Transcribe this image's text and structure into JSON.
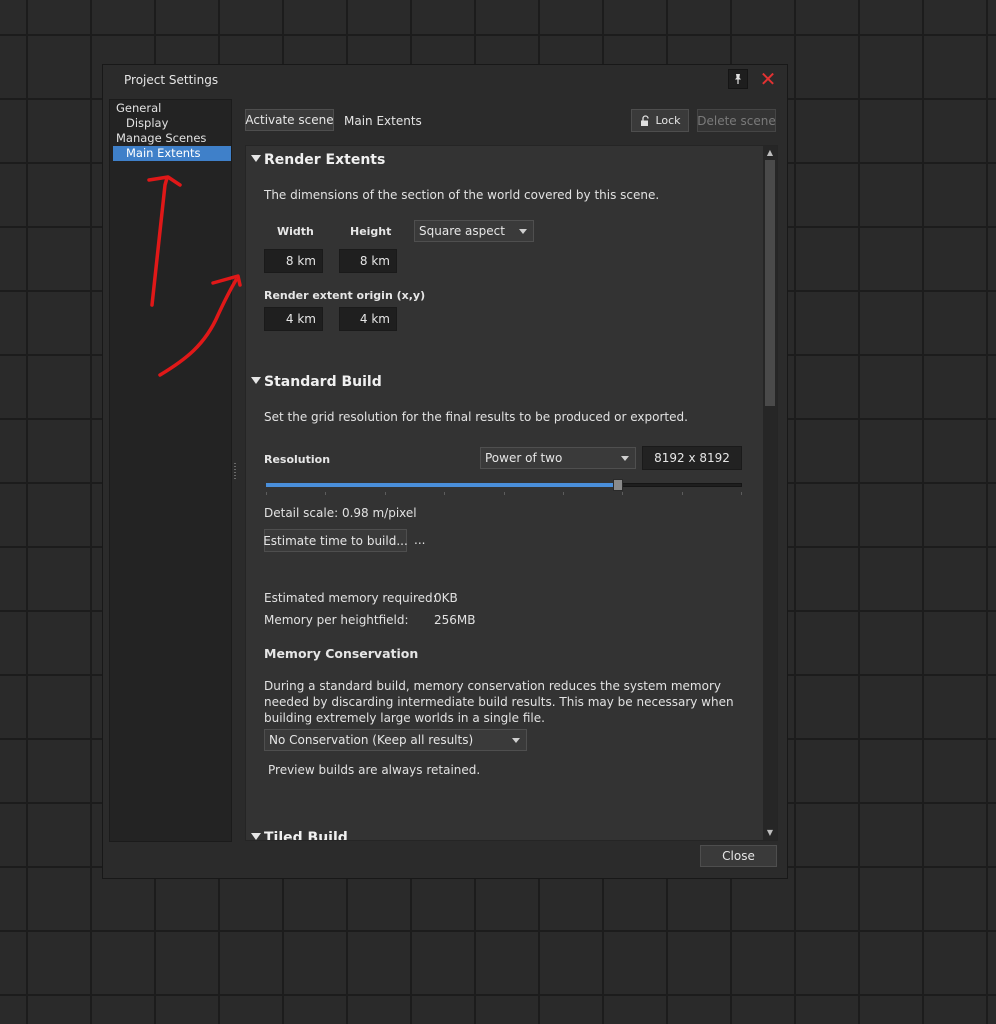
{
  "window": {
    "title": "Project Settings"
  },
  "tree": {
    "items": [
      {
        "label": "General",
        "indent": false,
        "selected": false
      },
      {
        "label": "Display",
        "indent": true,
        "selected": false
      },
      {
        "label": "Manage Scenes",
        "indent": false,
        "selected": false
      },
      {
        "label": "Main Extents",
        "indent": true,
        "selected": true
      }
    ]
  },
  "toolbar": {
    "activate_label": "Activate scene",
    "scene_name": "Main Extents",
    "lock_label": "Lock",
    "delete_label": "Delete scene"
  },
  "render_extents": {
    "title": "Render Extents",
    "description": "The dimensions of the section of the world covered by this scene.",
    "width_label": "Width",
    "height_label": "Height",
    "width_value": "8 km",
    "height_value": "8 km",
    "aspect_value": "Square aspect",
    "origin_label": "Render extent origin (x,y)",
    "origin_x": "4 km",
    "origin_y": "4 km"
  },
  "standard_build": {
    "title": "Standard Build",
    "description": "Set the grid resolution for the final results to be produced or exported.",
    "resolution_label": "Resolution",
    "resolution_mode": "Power of two",
    "resolution_value": "8192 x 8192",
    "slider_fraction": 0.74,
    "detail_scale": "Detail scale:  0.98 m/pixel",
    "estimate_label": "Estimate time to build...",
    "estimate_result": "...",
    "mem_required_label": "Estimated memory required:",
    "mem_required_value": "0KB",
    "mem_heightfield_label": "Memory per heightfield:",
    "mem_heightfield_value": "256MB",
    "conservation_title": "Memory Conservation",
    "conservation_text": "During a standard build, memory conservation reduces the system memory needed by discarding intermediate build results. This may be necessary when building extremely large worlds in a single file.",
    "conservation_value": "No Conservation (Keep all results)",
    "preview_note": "Preview builds are always retained."
  },
  "tiled_build": {
    "title": "Tiled Build"
  },
  "footer": {
    "close_label": "Close"
  },
  "colors": {
    "accent": "#3f80c9",
    "close_x": "#e33232",
    "annotation": "#e01818"
  }
}
